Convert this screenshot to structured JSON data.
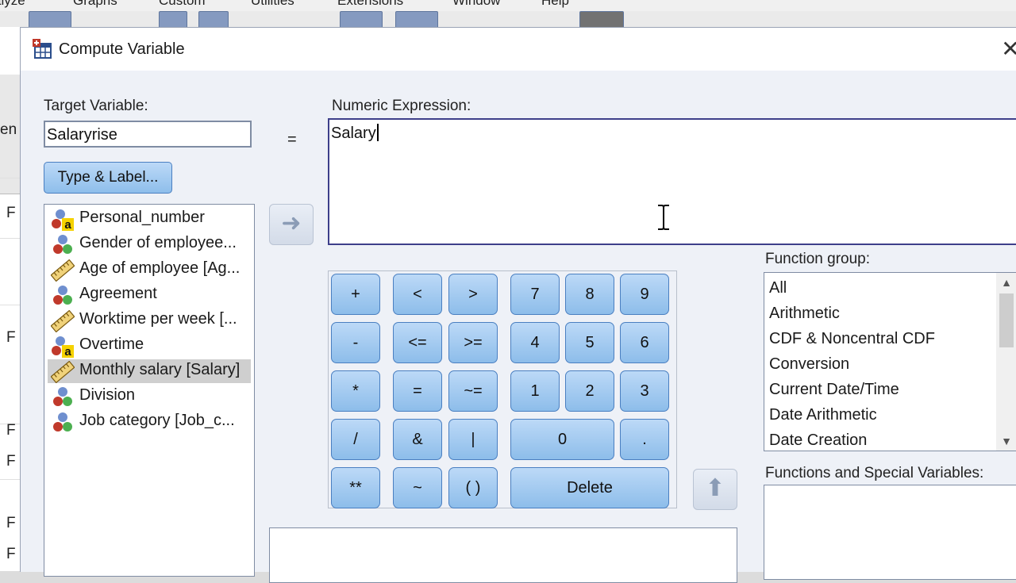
{
  "dialog": {
    "title": "Compute Variable",
    "close_glyph": "✕"
  },
  "target": {
    "label": "Target Variable:",
    "value": "Salaryrise",
    "type_label_button": "Type & Label..."
  },
  "equals_sign": "=",
  "expression": {
    "label": "Numeric Expression:",
    "value": "Salary"
  },
  "variables": [
    {
      "label": "Personal_number",
      "icon": "nominal-string-icon",
      "selected": false
    },
    {
      "label": "Gender of employee...",
      "icon": "nominal-icon",
      "selected": false
    },
    {
      "label": "Age of employee [Ag...",
      "icon": "scale-ruler-icon",
      "selected": false
    },
    {
      "label": "Agreement",
      "icon": "nominal-icon",
      "selected": false
    },
    {
      "label": "Worktime per week [...",
      "icon": "scale-ruler-icon",
      "selected": false
    },
    {
      "label": "Overtime",
      "icon": "nominal-string-icon",
      "selected": false
    },
    {
      "label": "Monthly salary [Salary]",
      "icon": "scale-ruler-icon",
      "selected": true
    },
    {
      "label": "Division",
      "icon": "nominal-icon",
      "selected": false
    },
    {
      "label": "Job category [Job_c...",
      "icon": "nominal-icon",
      "selected": false
    }
  ],
  "keypad": {
    "plus": "+",
    "lt": "<",
    "gt": ">",
    "k7": "7",
    "k8": "8",
    "k9": "9",
    "minus": "-",
    "le": "<=",
    "ge": ">=",
    "k4": "4",
    "k5": "5",
    "k6": "6",
    "mult": "*",
    "eq": "=",
    "ne": "~=",
    "k1": "1",
    "k2": "2",
    "k3": "3",
    "div": "/",
    "and": "&",
    "or": "|",
    "k0": "0",
    "dot": ".",
    "pow": "**",
    "not": "~",
    "parens": "( )",
    "delete": "Delete"
  },
  "function_group": {
    "label": "Function group:",
    "items": [
      "All",
      "Arithmetic",
      "CDF & Noncentral CDF",
      "Conversion",
      "Current Date/Time",
      "Date Arithmetic",
      "Date Creation"
    ]
  },
  "functions_special": {
    "label": "Functions and Special Variables:"
  },
  "background": {
    "menu": [
      "alyze",
      "Graphs",
      "Custom",
      "Utilities",
      "Extensions",
      "Window",
      "Help"
    ],
    "grid_header": "en",
    "grid_cells": [
      "F",
      "F",
      "F",
      "F",
      "F",
      "F"
    ]
  },
  "colors": {
    "button_gradient_top": "#bcd9f7",
    "button_gradient_bottom": "#8dbdea",
    "dialog_bg": "#eef1f7",
    "selected_row": "#cfcfcf",
    "expression_border": "#3d3f8a"
  }
}
